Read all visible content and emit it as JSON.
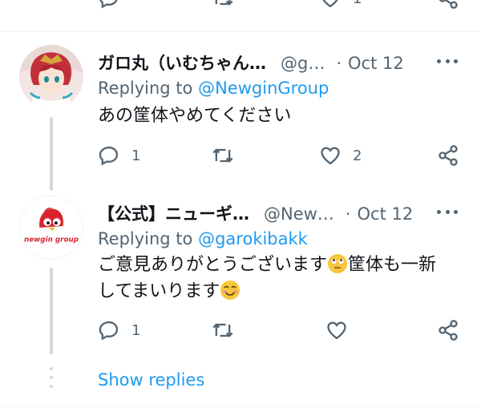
{
  "top_actions": {
    "reply_count": "",
    "retweet_count": "",
    "like_count": "1"
  },
  "tweets": [
    {
      "display_name": "ガロ丸（いむちゃん…",
      "handle": "@g…",
      "separator": "·",
      "time": "Oct 12",
      "replying_label": "Replying to",
      "replying_to": "@NewginGroup",
      "text_lines": [
        "あの筐体やめてください"
      ],
      "actions": {
        "reply_count": "1",
        "retweet_count": "",
        "like_count": "2"
      }
    },
    {
      "display_name": "【公式】ニューギ…",
      "handle": "@New…",
      "separator": "·",
      "time": "Oct 12",
      "replying_label": "Replying to",
      "replying_to": "@garokibakk",
      "text_lines": [
        "ご意見ありがとうございます",
        "筐体も一新",
        "してまいります"
      ],
      "avatar_logo": "newgin group",
      "actions": {
        "reply_count": "1",
        "retweet_count": "",
        "like_count": ""
      }
    }
  ],
  "show_replies_label": "Show replies",
  "colors": {
    "accent": "#1d9bf0",
    "muted": "#536471",
    "text": "#0f1419",
    "line": "#cfd9de"
  }
}
